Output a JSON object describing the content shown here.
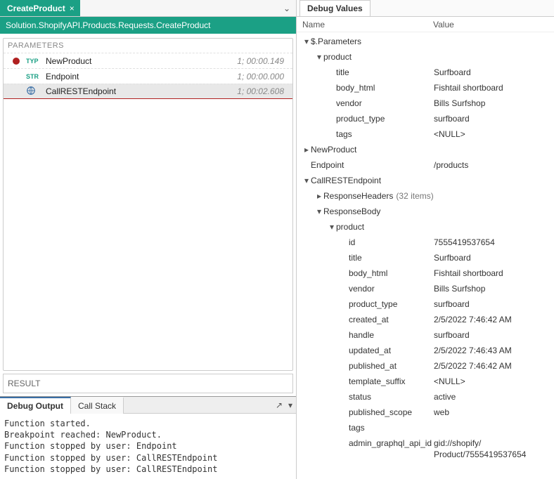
{
  "tab": {
    "title": "CreateProduct"
  },
  "breadcrumb": "Solution.ShopifyAPI.Products.Requests.CreateProduct",
  "sections": {
    "parameters_label": "PARAMETERS",
    "result_label": "RESULT"
  },
  "params": [
    {
      "icon": "TYP",
      "name": "NewProduct",
      "timing": "1; 00:00.149",
      "bp": true
    },
    {
      "icon": "STR",
      "name": "Endpoint",
      "timing": "1; 00:00.000",
      "bp": false
    },
    {
      "icon": "REST",
      "name": "CallRESTEndpoint",
      "timing": "1; 00:02.608",
      "bp": false,
      "selected": true
    }
  ],
  "bottom_tabs": {
    "debug_output": "Debug Output",
    "call_stack": "Call Stack"
  },
  "console": "Function started.\nBreakpoint reached: NewProduct.\nFunction stopped by user: Endpoint\nFunction stopped by user: CallRESTEndpoint\nFunction stopped by user: CallRESTEndpoint",
  "debug_values": {
    "tab": "Debug Values",
    "header": {
      "name": "Name",
      "value": "Value"
    },
    "rows": [
      {
        "d": 0,
        "a": "open",
        "label": "$.Parameters",
        "value": ""
      },
      {
        "d": 1,
        "a": "open",
        "label": "product",
        "value": ""
      },
      {
        "d": 2,
        "a": "none",
        "label": "title",
        "value": "Surfboard"
      },
      {
        "d": 2,
        "a": "none",
        "label": "body_html",
        "value": "Fishtail shortboard"
      },
      {
        "d": 2,
        "a": "none",
        "label": "vendor",
        "value": "Bills Surfshop"
      },
      {
        "d": 2,
        "a": "none",
        "label": "product_type",
        "value": "surfboard"
      },
      {
        "d": 2,
        "a": "none",
        "label": "tags",
        "value": "<NULL>"
      },
      {
        "d": 0,
        "a": "closed",
        "label": "NewProduct",
        "value": ""
      },
      {
        "d": 0,
        "a": "none",
        "label": "Endpoint",
        "value": "/products"
      },
      {
        "d": 0,
        "a": "open",
        "label": "CallRESTEndpoint",
        "value": ""
      },
      {
        "d": 1,
        "a": "closed",
        "label": "ResponseHeaders",
        "value": "",
        "count": "(32 items)"
      },
      {
        "d": 1,
        "a": "open",
        "label": "ResponseBody",
        "value": ""
      },
      {
        "d": 2,
        "a": "open",
        "label": "product",
        "value": ""
      },
      {
        "d": 3,
        "a": "none",
        "label": "id",
        "value": "7555419537654"
      },
      {
        "d": 3,
        "a": "none",
        "label": "title",
        "value": "Surfboard"
      },
      {
        "d": 3,
        "a": "none",
        "label": "body_html",
        "value": "Fishtail shortboard"
      },
      {
        "d": 3,
        "a": "none",
        "label": "vendor",
        "value": "Bills Surfshop"
      },
      {
        "d": 3,
        "a": "none",
        "label": "product_type",
        "value": "surfboard"
      },
      {
        "d": 3,
        "a": "none",
        "label": "created_at",
        "value": "2/5/2022 7:46:42 AM"
      },
      {
        "d": 3,
        "a": "none",
        "label": "handle",
        "value": "surfboard"
      },
      {
        "d": 3,
        "a": "none",
        "label": "updated_at",
        "value": "2/5/2022 7:46:43 AM"
      },
      {
        "d": 3,
        "a": "none",
        "label": "published_at",
        "value": "2/5/2022 7:46:42 AM"
      },
      {
        "d": 3,
        "a": "none",
        "label": "template_suffix",
        "value": "<NULL>"
      },
      {
        "d": 3,
        "a": "none",
        "label": "status",
        "value": "active"
      },
      {
        "d": 3,
        "a": "none",
        "label": "published_scope",
        "value": "web"
      },
      {
        "d": 3,
        "a": "none",
        "label": "tags",
        "value": ""
      },
      {
        "d": 3,
        "a": "none",
        "label": "admin_graphql_api_id",
        "value": "gid://shopify/\nProduct/7555419537654"
      }
    ]
  }
}
